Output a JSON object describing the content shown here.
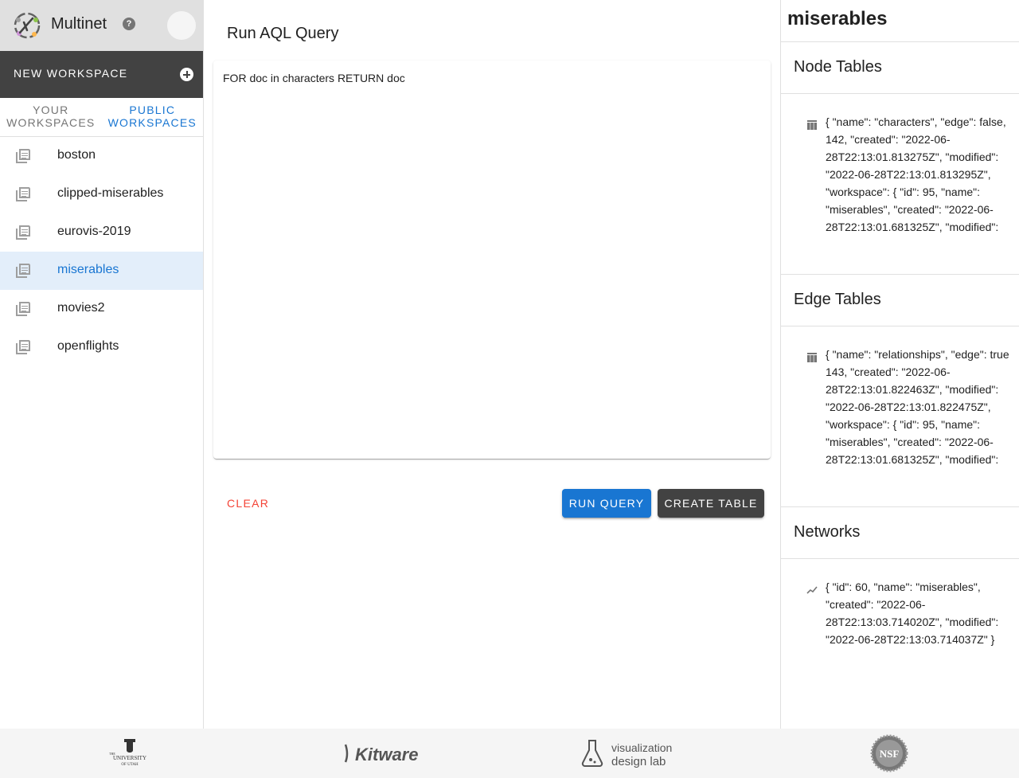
{
  "app": {
    "title": "Multinet",
    "help_icon": "question-circle-icon",
    "new_workspace_label": "NEW WORKSPACE"
  },
  "tabs": [
    {
      "label": "YOUR WORKSPACES",
      "active": false
    },
    {
      "label": "PUBLIC WORKSPACES",
      "active": true
    }
  ],
  "workspaces": [
    {
      "name": "boston",
      "active": false
    },
    {
      "name": "clipped-miserables",
      "active": false
    },
    {
      "name": "eurovis-2019",
      "active": false
    },
    {
      "name": "miserables",
      "active": true
    },
    {
      "name": "movies2",
      "active": false
    },
    {
      "name": "openflights",
      "active": false
    }
  ],
  "query": {
    "title": "Run AQL Query",
    "text": "FOR doc in characters RETURN doc",
    "clear_label": "CLEAR",
    "run_label": "RUN QUERY",
    "create_label": "CREATE TABLE"
  },
  "panel": {
    "workspace_title": "miserables",
    "node_tables": {
      "heading": "Node Tables",
      "item": "{ \"name\": \"characters\", \"edge\": false, 142, \"created\": \"2022-06-28T22:13:01.813275Z\", \"modified\": \"2022-06-28T22:13:01.813295Z\", \"workspace\": { \"id\": 95, \"name\": \"miserables\", \"created\": \"2022-06-28T22:13:01.681325Z\", \"modified\":"
    },
    "edge_tables": {
      "heading": "Edge Tables",
      "item": "{ \"name\": \"relationships\", \"edge\": true 143, \"created\": \"2022-06-28T22:13:01.822463Z\", \"modified\": \"2022-06-28T22:13:01.822475Z\", \"workspace\": { \"id\": 95, \"name\": \"miserables\", \"created\": \"2022-06-28T22:13:01.681325Z\", \"modified\":"
    },
    "networks": {
      "heading": "Networks",
      "item": "{ \"id\": 60, \"name\": \"miserables\", \"created\": \"2022-06-28T22:13:03.714020Z\", \"modified\": \"2022-06-28T22:13:03.714037Z\" }"
    }
  },
  "footer": {
    "uofu_logo_text": [
      "THE",
      "UNIVERSITY",
      "OF UTAH"
    ],
    "kitware_logo_text": "Kitware",
    "vdl_logo_text": [
      "visualization",
      "design lab"
    ],
    "nsf_logo_text": "NSF"
  }
}
